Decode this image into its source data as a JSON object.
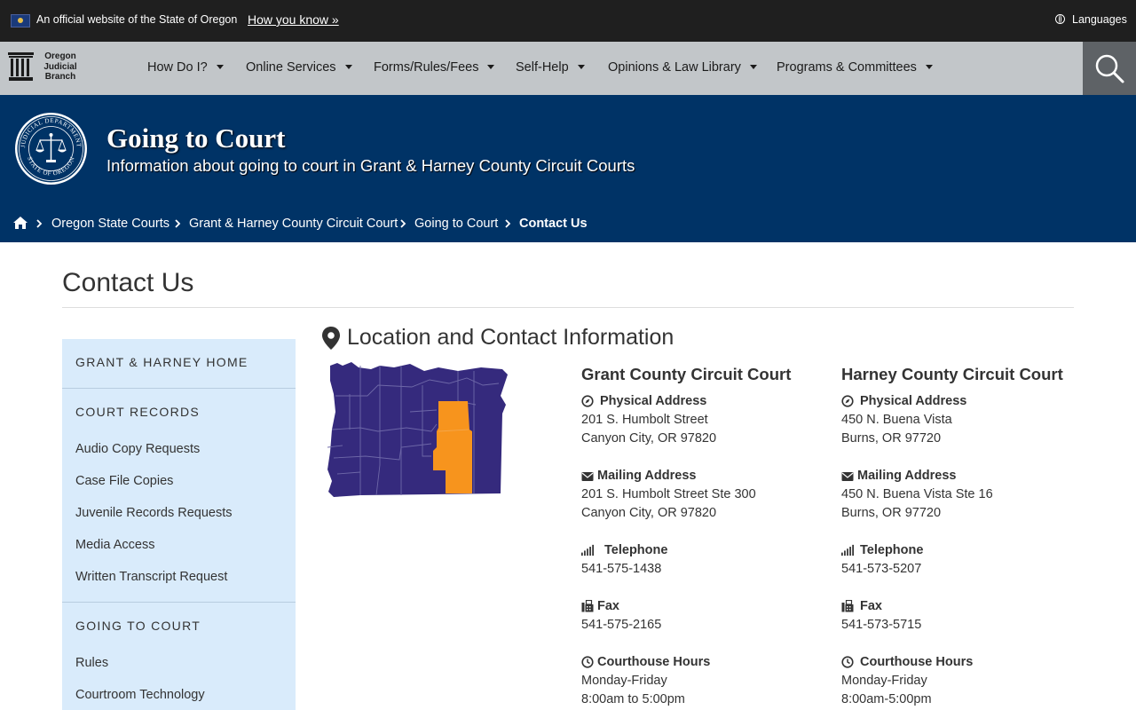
{
  "topbar": {
    "official": "An official website of the State of Oregon",
    "how_you_know": "How you know »",
    "languages": "Languages"
  },
  "logo": {
    "line1": "Oregon",
    "line2": "Judicial",
    "line3": "Branch"
  },
  "nav": {
    "items": [
      {
        "label": "How Do I?"
      },
      {
        "label": "Online Services"
      },
      {
        "label": "Forms/Rules/Fees"
      },
      {
        "label": "Self-Help"
      },
      {
        "label": "Opinions & Law Library"
      },
      {
        "label": "Programs & Committees"
      }
    ],
    "search_icon": "search-icon"
  },
  "hero": {
    "title": "Going to Court",
    "subtitle": "Information about going to court in Grant & Harney County Circuit Courts",
    "seal_text_top": "JUDICIAL DEPARTMENT",
    "seal_text_bottom": "STATE OF OREGON"
  },
  "breadcrumb": {
    "items": [
      "Oregon State Courts",
      "Grant & Harney County Circuit Court",
      "Going to Court",
      "Contact Us"
    ]
  },
  "page": {
    "title": "Contact Us"
  },
  "sidebar": {
    "home": "GRANT & HARNEY HOME",
    "section1": {
      "title": "COURT RECORDS",
      "links": [
        "Audio Copy Requests",
        "Case File Copies",
        "Juvenile Records Requests",
        "Media Access",
        "Written Transcript Request"
      ]
    },
    "section2": {
      "title": "GOING TO COURT",
      "links": [
        "Rules",
        "Courtroom Technology"
      ]
    }
  },
  "content": {
    "section_title": "Location and Contact Information",
    "courts": [
      {
        "name": "Grant County Circuit Court",
        "physical_label": "Physical Address",
        "physical": [
          "201 S. Humbolt Street",
          "Canyon City, OR 97820"
        ],
        "mailing_label": "Mailing Address",
        "mailing": [
          "201 S. Humbolt Street Ste 300",
          "Canyon City, OR 97820"
        ],
        "telephone_label": "Telephone",
        "telephone": "541-575-1438",
        "fax_label": "Fax",
        "fax": "541-575-2165",
        "hours_label": "Courthouse Hours",
        "hours": [
          "Monday-Friday",
          "8:00am to 5:00pm"
        ]
      },
      {
        "name": "Harney County Circuit Court",
        "physical_label": "Physical Address",
        "physical": [
          "450 N. Buena Vista",
          "Burns, OR 97720"
        ],
        "mailing_label": "Mailing Address",
        "mailing": [
          "450 N. Buena Vista Ste 16",
          "Burns, OR 97720"
        ],
        "telephone_label": "Telephone",
        "telephone": "541-573-5207",
        "fax_label": "Fax",
        "fax": "541-573-5715",
        "hours_label": "Courthouse Hours",
        "hours": [
          "Monday-Friday",
          "8:00am-5:00pm"
        ]
      }
    ]
  },
  "colors": {
    "topbar": "#1f1f1f",
    "navbar": "#c2c6c9",
    "hero": "#003366",
    "sidebar": "#d9ebfb",
    "map_counties": "#352a7d",
    "map_highlight": "#f7941d"
  }
}
